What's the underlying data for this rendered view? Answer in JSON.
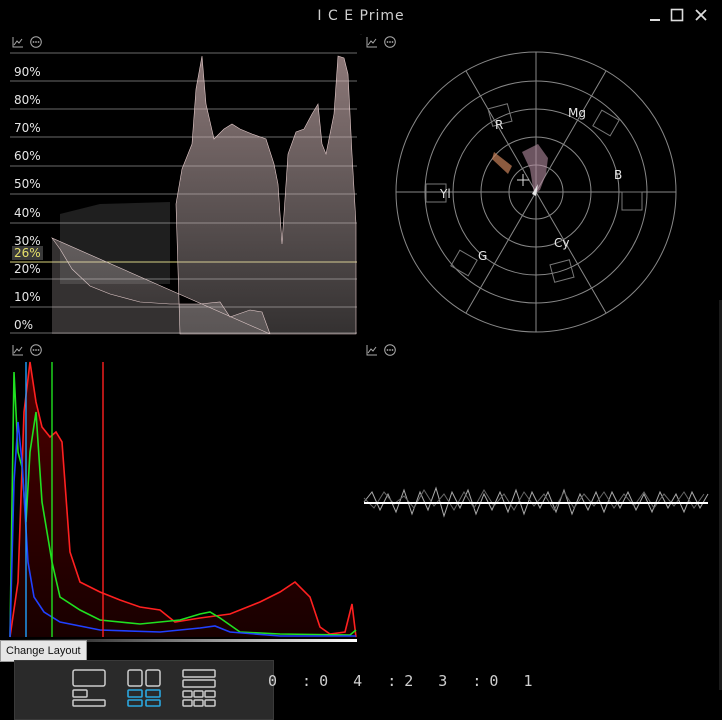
{
  "window": {
    "title": "I C E Prime"
  },
  "waveform": {
    "labels": [
      "90%",
      "80%",
      "70%",
      "60%",
      "50%",
      "40%",
      "30%",
      "20%",
      "10%",
      "0%"
    ],
    "marker_label": "26%"
  },
  "vectorscope": {
    "labels": {
      "R": "R",
      "Mg": "Mg",
      "B": "B",
      "Yl": "Yl",
      "G": "G",
      "Cy": "Cy"
    }
  },
  "tooltip": "Change Layout",
  "timecode": "0 :0 4 :2 3 :0 1",
  "colors": {
    "accent": "#2aa8e0",
    "red": "#ff2020",
    "green": "#20e020",
    "blue": "#2040ff",
    "marker": "#e6e06a"
  },
  "icons": [
    "chart-icon",
    "more-icon",
    "minimize-icon",
    "maximize-icon",
    "close-icon"
  ]
}
